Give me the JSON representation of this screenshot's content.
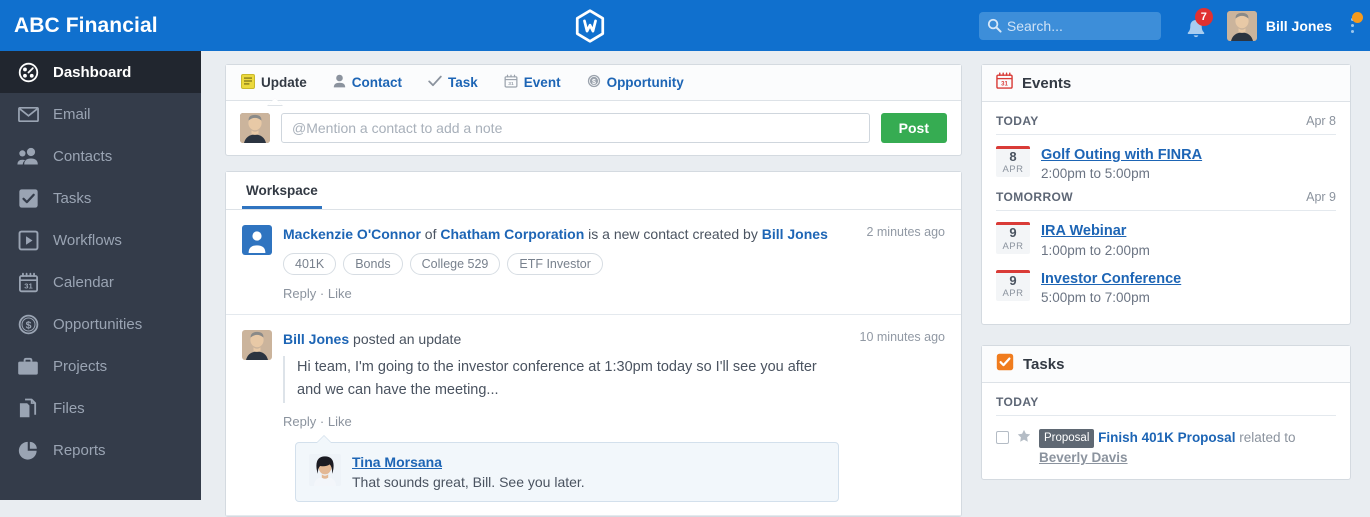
{
  "header": {
    "brand": "ABC Financial",
    "logo_icon": "hexagon-w-logo",
    "search": {
      "placeholder": "Search...",
      "value": "",
      "icon": "search-icon"
    },
    "notifications": {
      "icon": "bell-icon",
      "count": "7"
    },
    "user": {
      "name": "Bill Jones",
      "avatar_icon": "user-avatar"
    },
    "overflow": {
      "icon": "kebab-menu-icon",
      "has_badge": true
    },
    "colors": {
      "bar": "#1070ce",
      "badge": "#e03131",
      "dot": "#f59a1e"
    }
  },
  "sidebar": {
    "items": [
      {
        "label": "Dashboard",
        "icon": "dashboard-icon",
        "active": true
      },
      {
        "label": "Email",
        "icon": "envelope-icon",
        "active": false
      },
      {
        "label": "Contacts",
        "icon": "contacts-icon",
        "active": false
      },
      {
        "label": "Tasks",
        "icon": "check-square-icon",
        "active": false
      },
      {
        "label": "Workflows",
        "icon": "play-square-icon",
        "active": false
      },
      {
        "label": "Calendar",
        "icon": "calendar-31-icon",
        "active": false
      },
      {
        "label": "Opportunities",
        "icon": "dollar-coin-icon",
        "active": false
      },
      {
        "label": "Projects",
        "icon": "briefcase-icon",
        "active": false
      },
      {
        "label": "Files",
        "icon": "files-icon",
        "active": false
      },
      {
        "label": "Reports",
        "icon": "pie-chart-icon",
        "active": false
      }
    ]
  },
  "composer": {
    "tabs": [
      {
        "label": "Update",
        "icon": "note-icon",
        "active": true
      },
      {
        "label": "Contact",
        "icon": "person-icon",
        "active": false
      },
      {
        "label": "Task",
        "icon": "check-icon",
        "active": false
      },
      {
        "label": "Event",
        "icon": "calendar-icon",
        "active": false
      },
      {
        "label": "Opportunity",
        "icon": "dollar-coin-icon",
        "active": false
      }
    ],
    "input": {
      "placeholder": "@Mention a contact to add a note",
      "value": ""
    },
    "post_label": "Post"
  },
  "feed": {
    "tab_label": "Workspace",
    "items": [
      {
        "type": "new-contact",
        "avatar_icon": "contact-avatar-icon",
        "headline": {
          "person": "Mackenzie O'Connor",
          "of": " of ",
          "company": "Chatham Corporation",
          "middle": " is a new contact created by ",
          "creator": "Bill Jones"
        },
        "time": "2 minutes ago",
        "tags": [
          "401K",
          "Bonds",
          "College 529",
          "ETF Investor"
        ],
        "actions": {
          "reply": "Reply",
          "sep": "·",
          "like": "Like"
        }
      },
      {
        "type": "update",
        "avatar_icon": "bill-jones-avatar",
        "author": "Bill Jones",
        "action_text": " posted an update",
        "time": "10 minutes ago",
        "body": "Hi team, I'm going to the investor conference at 1:30pm today so I'll see you after and we can have the meeting...",
        "actions": {
          "reply": "Reply",
          "sep": "·",
          "like": "Like"
        },
        "comment": {
          "avatar_icon": "tina-morsana-avatar",
          "name": "Tina Morsana",
          "text": "That sounds great, Bill. See you later."
        }
      }
    ]
  },
  "events_panel": {
    "title": "Events",
    "icon": "calendar-31-icon",
    "groups": [
      {
        "label": "TODAY",
        "date": "Apr 8",
        "events": [
          {
            "day": "8",
            "month": "APR",
            "name": "Golf Outing with FINRA",
            "time": "2:00pm to 5:00pm"
          }
        ]
      },
      {
        "label": "TOMORROW",
        "date": "Apr 9",
        "events": [
          {
            "day": "9",
            "month": "APR",
            "name": "IRA Webinar",
            "time": "1:00pm to 2:00pm"
          },
          {
            "day": "9",
            "month": "APR",
            "name": "Investor Conference",
            "time": "5:00pm to 7:00pm"
          }
        ]
      }
    ]
  },
  "tasks_panel": {
    "title": "Tasks",
    "icon": "check-square-icon",
    "icon_color": "#f07c1e",
    "group_label": "TODAY",
    "tasks": [
      {
        "checked": false,
        "starred": false,
        "badge": "Proposal",
        "name": "Finish 401K Proposal",
        "relation_text": " related to ",
        "related_to": "Beverly Davis"
      }
    ]
  }
}
